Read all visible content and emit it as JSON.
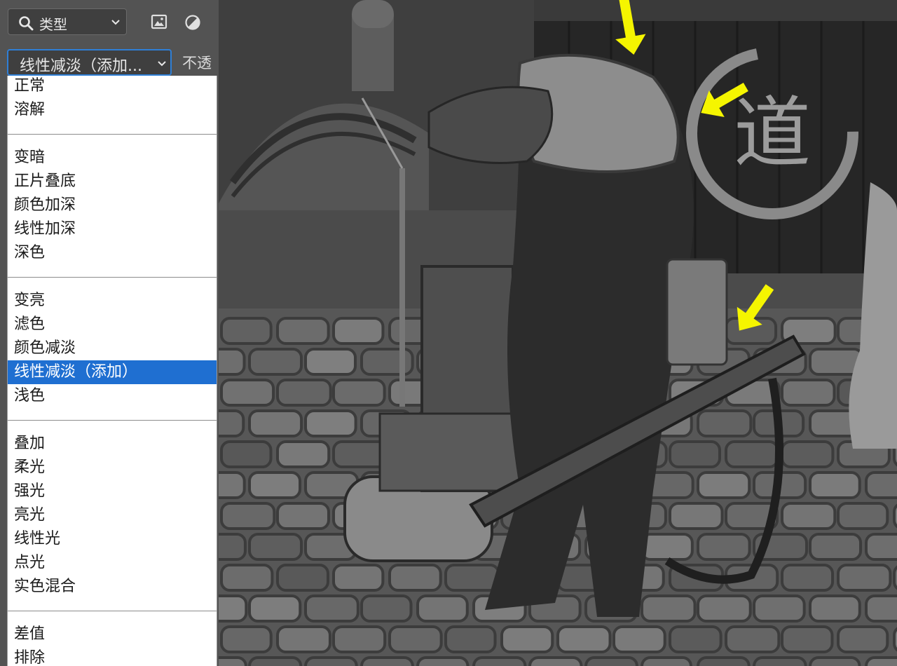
{
  "panel": {
    "filter": {
      "label": "类型",
      "icon": "search-icon"
    },
    "icons": [
      "image-filter-icon",
      "adjustment-filter-icon"
    ],
    "blend_mode": {
      "value": "线性减淡（添加..."
    },
    "opacity_label": "不透"
  },
  "blend_menu": {
    "groups": [
      [
        "正常",
        "溶解"
      ],
      [
        "变暗",
        "正片叠底",
        "颜色加深",
        "线性加深",
        "深色"
      ],
      [
        "变亮",
        "滤色",
        "颜色减淡",
        "线性减淡（添加）",
        "浅色"
      ],
      [
        "叠加",
        "柔光",
        "强光",
        "亮光",
        "线性光",
        "点光",
        "实色混合"
      ],
      [
        "差值",
        "排除"
      ]
    ],
    "selected": "线性减淡（添加）"
  },
  "canvas": {
    "banner_glyph": "道",
    "arrow_color": "#f5f500"
  },
  "colors": {
    "panel_bg": "#535353",
    "accent": "#1f6fd1",
    "focus_border": "#2f7fd6"
  }
}
